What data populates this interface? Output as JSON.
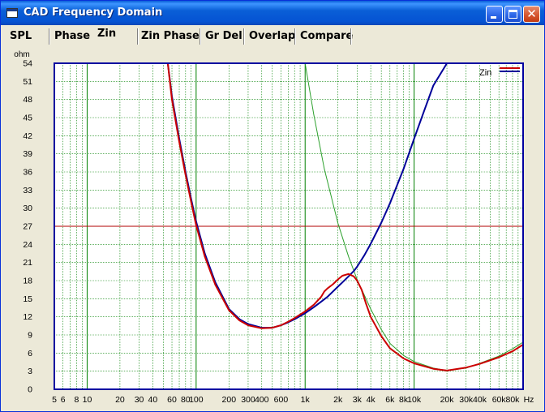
{
  "window": {
    "title": "CAD Frequency Domain"
  },
  "tabs": [
    {
      "label": "SPL",
      "active": false
    },
    {
      "label": "Phase",
      "active": false
    },
    {
      "label": "Zin",
      "active": true
    },
    {
      "label": "Zin Phase",
      "active": false
    },
    {
      "label": "Gr Del",
      "active": false
    },
    {
      "label": "Overlap",
      "active": false
    },
    {
      "label": "Compare",
      "active": false
    }
  ],
  "colors": {
    "plot_background": "#ffffff",
    "plot_frame": "#0000a0",
    "grid": "#008000",
    "reference_line": "#b00000",
    "curve_red": "#cc0000",
    "curve_blue": "#000099",
    "curve_green": "#2ca02c"
  },
  "chart_data": {
    "type": "line",
    "title": "",
    "ylabel": "ohm",
    "xlabel": "Hz",
    "x_scale": "log",
    "xlim": [
      5,
      100000
    ],
    "ylim": [
      0,
      54
    ],
    "yticks": [
      0,
      3,
      6,
      9,
      12,
      15,
      18,
      21,
      24,
      27,
      30,
      33,
      36,
      39,
      42,
      45,
      48,
      51,
      54
    ],
    "xtick_labels": [
      {
        "x": 5,
        "label": "5"
      },
      {
        "x": 6,
        "label": "6"
      },
      {
        "x": 8,
        "label": "8"
      },
      {
        "x": 10,
        "label": "10"
      },
      {
        "x": 20,
        "label": "20"
      },
      {
        "x": 30,
        "label": "30"
      },
      {
        "x": 40,
        "label": "40"
      },
      {
        "x": 60,
        "label": "60"
      },
      {
        "x": 80,
        "label": "80"
      },
      {
        "x": 100,
        "label": "100"
      },
      {
        "x": 200,
        "label": "200"
      },
      {
        "x": 300,
        "label": "300"
      },
      {
        "x": 400,
        "label": "400"
      },
      {
        "x": 600,
        "label": "600"
      },
      {
        "x": 1000,
        "label": "1k"
      },
      {
        "x": 2000,
        "label": "2k"
      },
      {
        "x": 3000,
        "label": "3k"
      },
      {
        "x": 4000,
        "label": "4k"
      },
      {
        "x": 6000,
        "label": "6k"
      },
      {
        "x": 8000,
        "label": "8k"
      },
      {
        "x": 10000,
        "label": "10k"
      },
      {
        "x": 20000,
        "label": "20k"
      },
      {
        "x": 30000,
        "label": "30k"
      },
      {
        "x": 40000,
        "label": "40k"
      },
      {
        "x": 60000,
        "label": "60k"
      },
      {
        "x": 80000,
        "label": "80k"
      }
    ],
    "grid": true,
    "legend": {
      "placement": "top-right",
      "label": "Zin"
    },
    "reference_lines": [
      {
        "y": 27
      }
    ],
    "series": [
      {
        "name": "Zin",
        "color": "#cc0000",
        "x": [
          55,
          60,
          70,
          80,
          90,
          100,
          120,
          150,
          200,
          250,
          300,
          400,
          500,
          600,
          700,
          800,
          1000,
          1200,
          1400,
          1500,
          1600,
          1800,
          2000,
          2200,
          2500,
          2800,
          3000,
          3300,
          3600,
          4000,
          5000,
          6000,
          8000,
          10000,
          15000,
          20000,
          30000,
          40000,
          60000,
          80000,
          100000
        ],
        "y": [
          54,
          48,
          41,
          35.5,
          31,
          27.2,
          22,
          17.3,
          13.1,
          11.4,
          10.6,
          10.1,
          10.2,
          10.6,
          11.2,
          11.8,
          12.9,
          14,
          15.3,
          16.2,
          16.7,
          17.4,
          18.2,
          18.8,
          19.1,
          18.7,
          18,
          16.5,
          14.3,
          12,
          8.8,
          6.8,
          5.1,
          4.3,
          3.4,
          3.1,
          3.6,
          4.2,
          5.3,
          6.3,
          7.4
        ]
      },
      {
        "name": "",
        "color": "#000099",
        "x": [
          55,
          60,
          70,
          80,
          90,
          100,
          120,
          150,
          200,
          250,
          300,
          400,
          500,
          600,
          700,
          800,
          1000,
          1200,
          1400,
          1600,
          1800,
          2000,
          2200,
          2500,
          2800,
          3000,
          3500,
          4000,
          5000,
          6000,
          8000,
          10000,
          12000,
          15000,
          20000,
          24000
        ],
        "y": [
          54,
          48.5,
          41.5,
          36,
          31.5,
          27.8,
          22.5,
          17.7,
          13.3,
          11.6,
          10.8,
          10.2,
          10.2,
          10.6,
          11.1,
          11.6,
          12.6,
          13.6,
          14.5,
          15.3,
          16.2,
          17,
          17.7,
          18.7,
          19.6,
          20.3,
          22.2,
          24.1,
          27.6,
          30.8,
          36.5,
          41.5,
          45.5,
          50.3,
          54,
          57
        ]
      },
      {
        "name": "",
        "color": "#2ca02c",
        "x": [
          1000,
          1200,
          1500,
          2000,
          2500,
          3000,
          4000,
          5000,
          6000,
          8000,
          10000,
          15000,
          20000,
          30000,
          40000,
          60000,
          80000,
          100000
        ],
        "y": [
          54,
          45.5,
          36.5,
          27.5,
          22,
          18.2,
          13.3,
          9.9,
          7.6,
          5.6,
          4.6,
          3.5,
          3.1,
          3.5,
          4.3,
          5.5,
          6.7,
          7.8
        ]
      }
    ]
  }
}
